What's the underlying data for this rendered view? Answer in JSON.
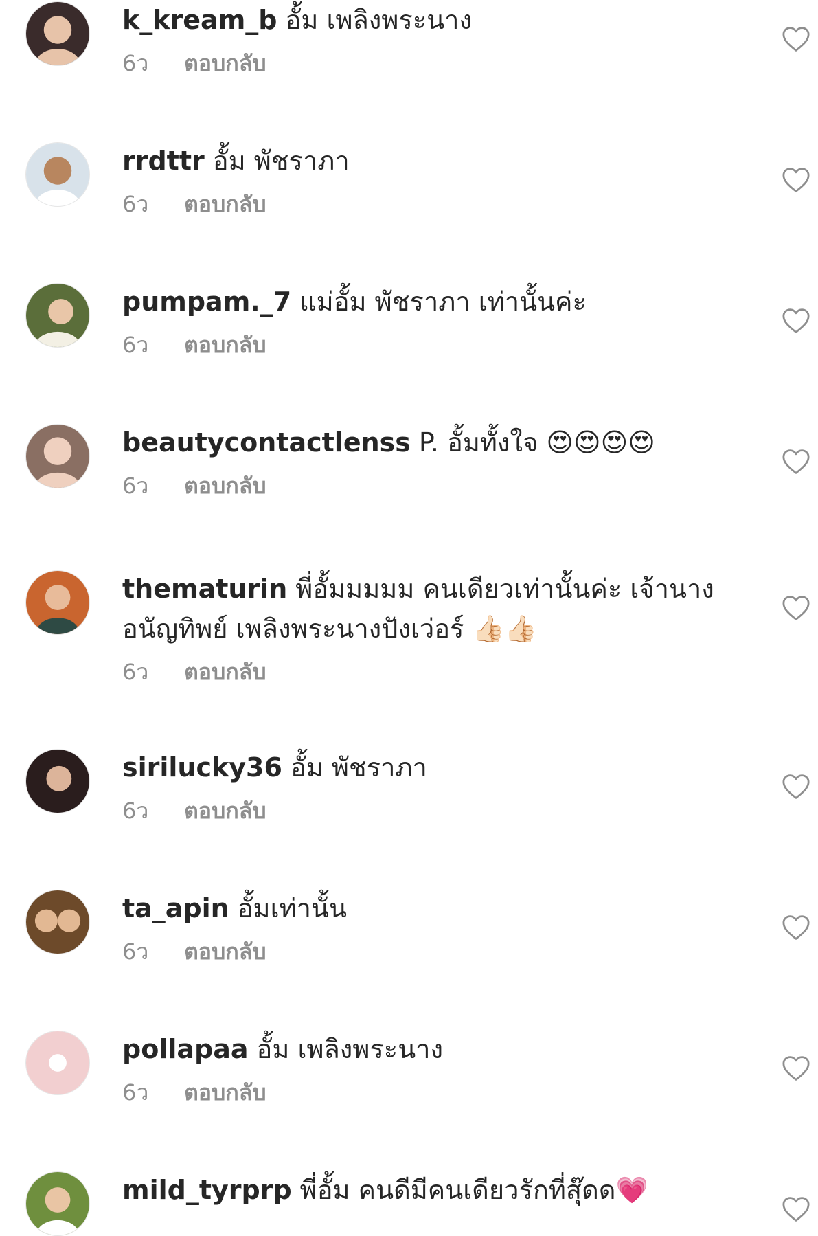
{
  "comments": [
    {
      "username": "k_kream_b",
      "text": "อั้ม เพลิงพระนาง",
      "time": "6ว",
      "reply": "ตอบกลับ",
      "avatar_bg": "#3a2b2b",
      "avatar_fg": "#e7c3a9"
    },
    {
      "username": "rrdttr",
      "text": "อั้ม พัชราภา",
      "time": "6ว",
      "reply": "ตอบกลับ",
      "avatar_bg": "#d8e2ea",
      "avatar_fg": "#b8865f"
    },
    {
      "username": "pumpam._7",
      "text": "แม่อั้ม พัชราภา เท่านั้นค่ะ",
      "time": "6ว",
      "reply": "ตอบกลับ",
      "avatar_bg": "#5b6e3a",
      "avatar_fg": "#e9c6a8"
    },
    {
      "username": "beautycontactlenss",
      "text": "P. อั้มทั้งใจ 😍😍😍😍",
      "time": "6ว",
      "reply": "ตอบกลับ",
      "avatar_bg": "#8a6f63",
      "avatar_fg": "#efd0bf"
    },
    {
      "username": "thematurin",
      "text": "พี่อั้มมมมม คนเดียวเท่านั้นค่ะ เจ้านาง อนัญทิพย์ เพลิงพระนางปังเว่อร์ 👍🏻👍🏻",
      "time": "6ว",
      "reply": "ตอบกลับ",
      "avatar_bg": "#c9652f",
      "avatar_fg": "#e8bb9a"
    },
    {
      "username": "sirilucky36",
      "text": "อั้ม พัชราภา",
      "time": "6ว",
      "reply": "ตอบกลับ",
      "avatar_bg": "#2a1d1d",
      "avatar_fg": "#dcb49a"
    },
    {
      "username": "ta_apin",
      "text": "อั้มเท่านั้น",
      "time": "6ว",
      "reply": "ตอบกลับ",
      "avatar_bg": "#6d4a2a",
      "avatar_fg": "#e2b893"
    },
    {
      "username": "pollapaa",
      "text": "อั้ม เพลิงพระนาง",
      "time": "6ว",
      "reply": "ตอบกลับ",
      "avatar_bg": "#f2cfd0",
      "avatar_fg": "#ffffff"
    },
    {
      "username": "mild_tyrprp",
      "text": "พี่อั้ม คนดีมีคนเดียวรักที่สุ๊ดด💗",
      "time": "",
      "reply": "",
      "avatar_bg": "#6f8f3e",
      "avatar_fg": "#e9c5a4"
    }
  ],
  "icons": {
    "like": "heart-outline-icon"
  },
  "colors": {
    "text": "#262626",
    "meta": "#8e8e8e",
    "icon": "#8e8e8e"
  }
}
